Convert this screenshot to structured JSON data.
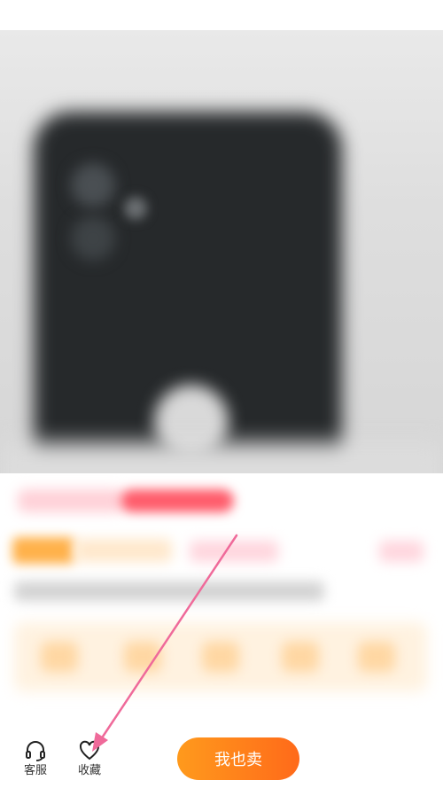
{
  "bottom_bar": {
    "customer_service_label": "客服",
    "favorite_label": "收藏",
    "sell_button_label": "我也卖"
  },
  "colors": {
    "accent": "#ff7a1a",
    "annotation_arrow": "#ef6a9a"
  },
  "icons": {
    "customer_service": "headset-icon",
    "favorite": "heart-icon"
  }
}
